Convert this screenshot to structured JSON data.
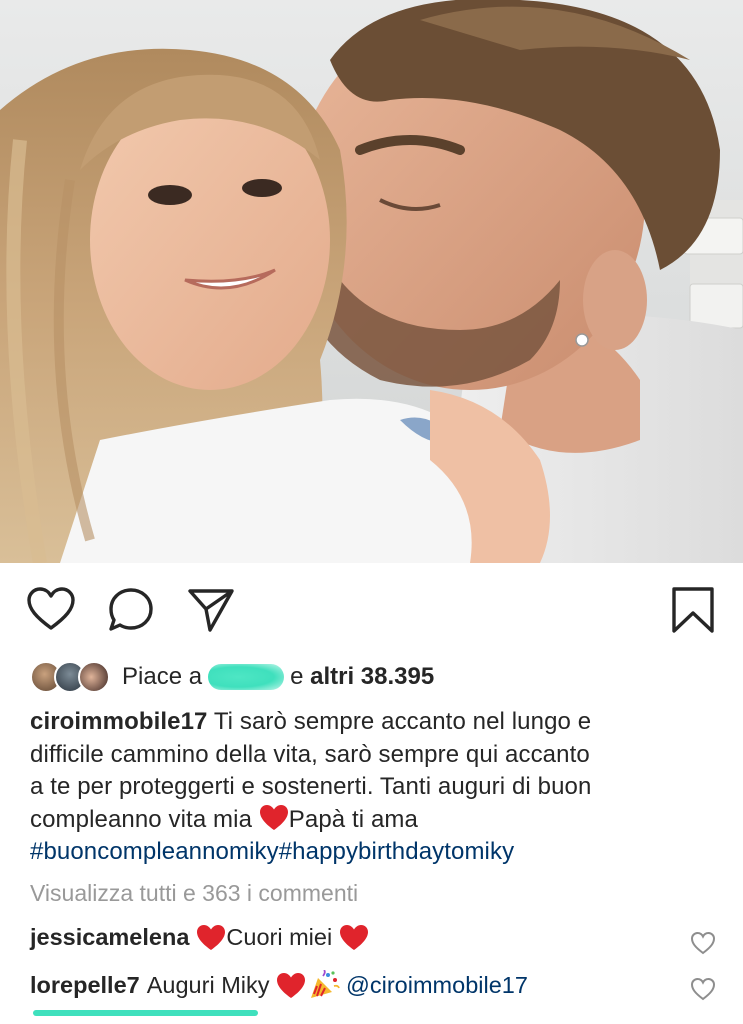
{
  "post": {
    "likes": {
      "prefix": "Piace a",
      "middle": "e",
      "count_text": "altri 38.395"
    },
    "caption": {
      "username": "ciroimmobile17",
      "line1": "Ti sarò sempre accanto nel lungo e",
      "line2": "difficile cammino della vita, sarò sempre qui accanto",
      "line3": "a te per proteggerti e sostenerti. Tanti auguri di buon",
      "line4a": "compleanno vita mia",
      "line4b": "Papà ti ama",
      "hashtags": "#buoncompleannomiky#happybirthdaytomiky"
    },
    "view_all_comments": "Visualizza tutti e 363 i commenti",
    "comments": [
      {
        "username": "jessicamelena",
        "text_a": "Cuori miei",
        "text_b": ""
      },
      {
        "username": "lorepelle7",
        "text_a": "Auguri Miky",
        "mention": "@ciroimmobile17"
      }
    ]
  },
  "colors": {
    "text": "#262626",
    "hashtag": "#003569",
    "muted": "#999999",
    "heart_emoji": "#e0242c",
    "highlight": "#3fe0bd"
  },
  "icons": [
    "heart-outline-icon",
    "comment-bubble-icon",
    "share-paper-plane-icon",
    "bookmark-icon",
    "red-heart-emoji",
    "party-popper-emoji",
    "small-heart-icon"
  ]
}
